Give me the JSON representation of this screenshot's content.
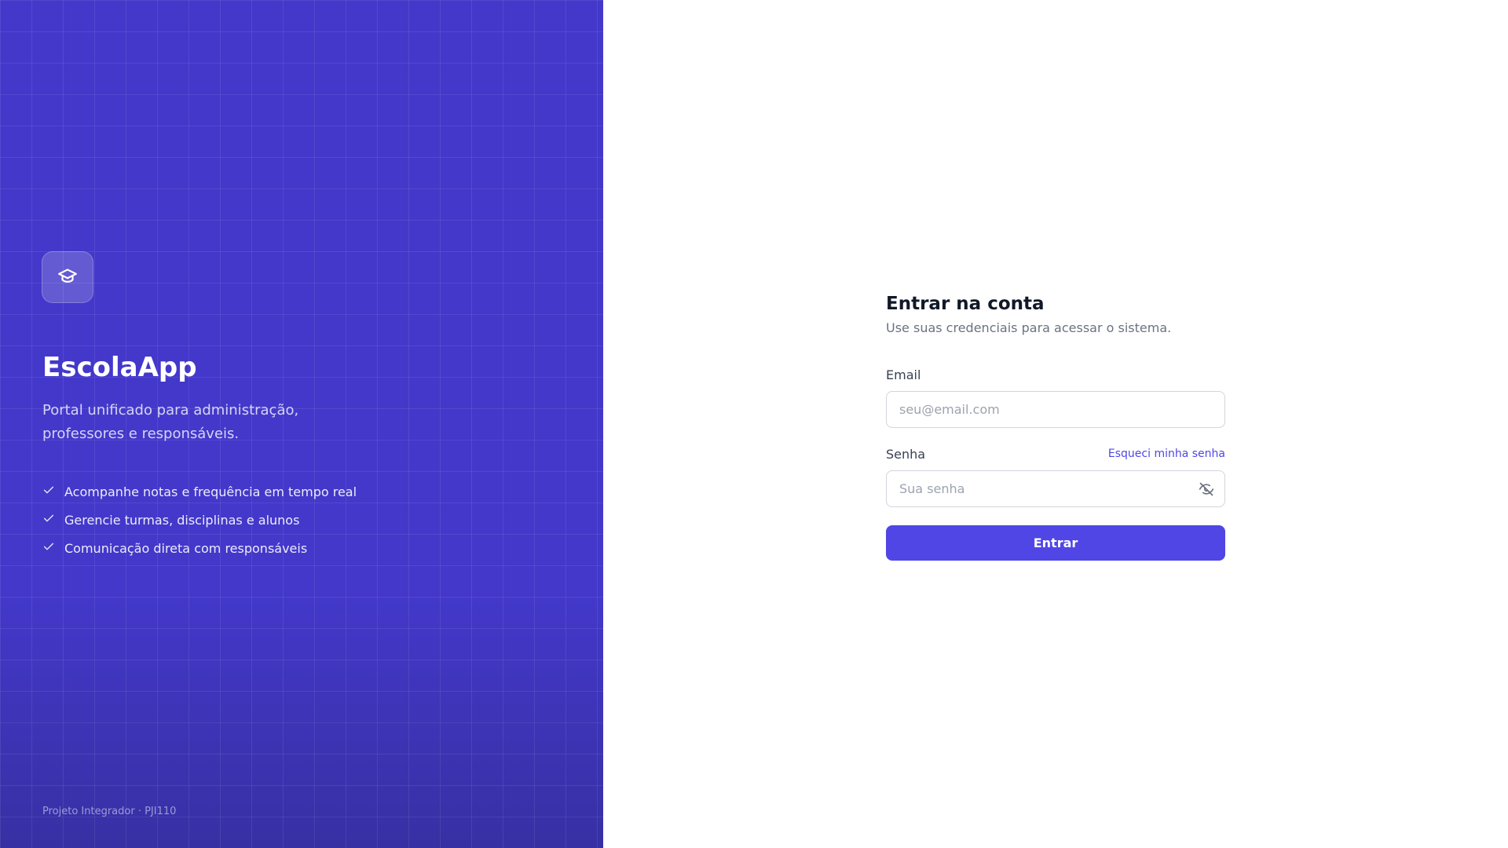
{
  "brand": {
    "name": "EscolaApp",
    "tagline": "Portal unificado para administração, professores e responsáveis.",
    "logo_icon": "graduation-cap-icon"
  },
  "features": [
    "Acompanhe notas e frequência em tempo real",
    "Gerencie turmas, disciplinas e alunos",
    "Comunicação direta com responsáveis"
  ],
  "footer": {
    "note": "Projeto Integrador · PJI110"
  },
  "login": {
    "title": "Entrar na conta",
    "subtitle": "Use suas credenciais para acessar o sistema.",
    "email_label": "Email",
    "email_placeholder": "seu@email.com",
    "email_value": "",
    "password_label": "Senha",
    "password_placeholder": "Sua senha",
    "password_value": "",
    "forgot_label": "Esqueci minha senha",
    "submit_label": "Entrar",
    "password_toggle_icon": "eye-off-icon"
  },
  "colors": {
    "panel": "#4338ca",
    "accent": "#4f46e5",
    "title": "#111827",
    "muted": "#6b7280"
  }
}
